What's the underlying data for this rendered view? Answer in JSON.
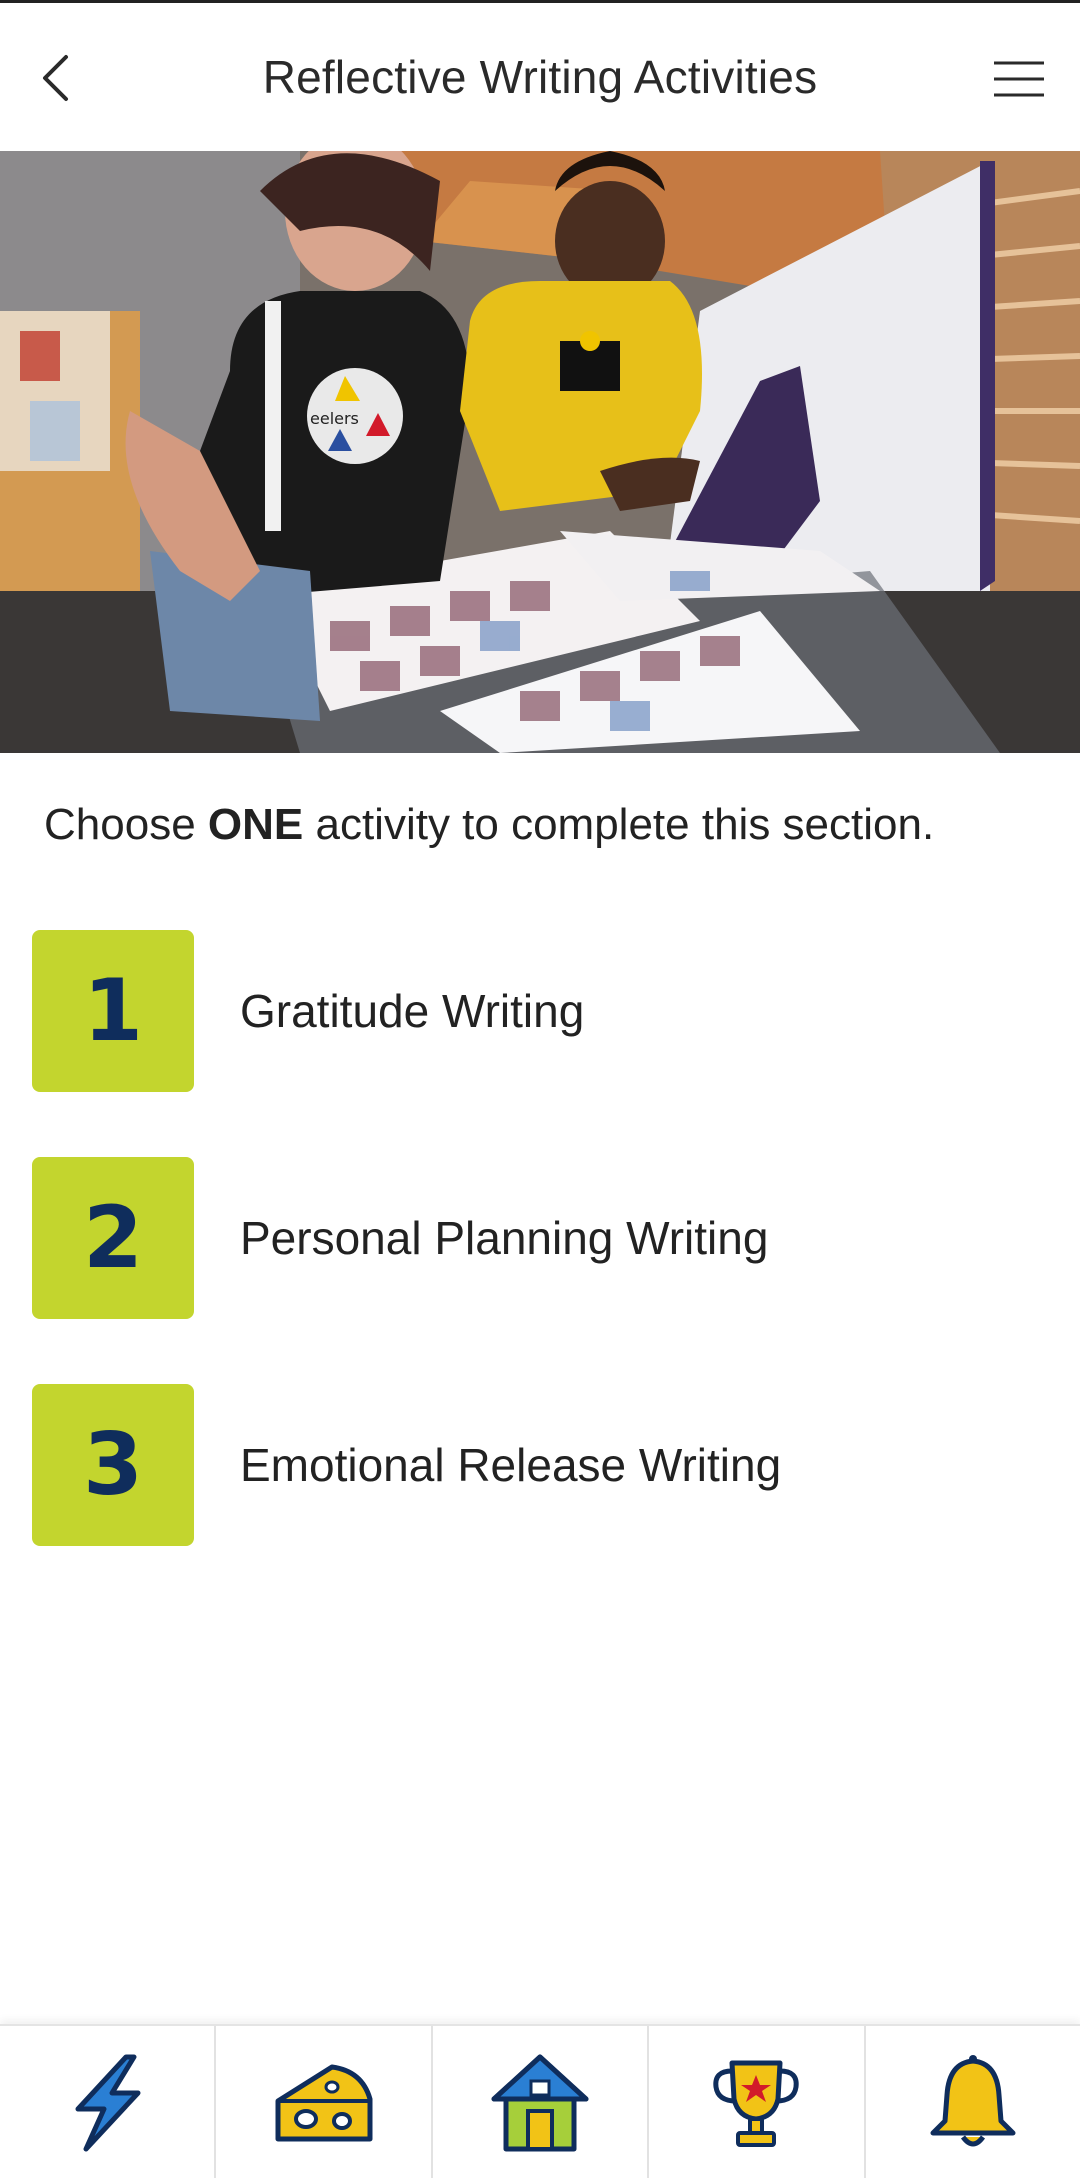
{
  "header": {
    "title": "Reflective Writing Activities",
    "back_icon": "chevron-left-icon",
    "menu_icon": "hamburger-menu-icon"
  },
  "hero": {
    "jersey_text": "eelers"
  },
  "instructions": {
    "prefix": "Choose ",
    "emphasis": "ONE",
    "suffix": " activity to complete this section."
  },
  "activities": [
    {
      "number": "1",
      "label": "Gratitude Writing"
    },
    {
      "number": "2",
      "label": "Personal Planning Writing"
    },
    {
      "number": "3",
      "label": "Emotional Release Writing"
    }
  ],
  "bottom_nav": [
    {
      "icon": "lightning-bolt-icon"
    },
    {
      "icon": "cheese-icon"
    },
    {
      "icon": "home-icon"
    },
    {
      "icon": "trophy-icon"
    },
    {
      "icon": "bell-icon"
    }
  ],
  "colors": {
    "number_box": "#c3d52e",
    "number_text": "#0f2d5c",
    "icon_outline": "#0f2d5c",
    "icon_yellow": "#f2c316",
    "icon_blue": "#2a7fd4"
  }
}
